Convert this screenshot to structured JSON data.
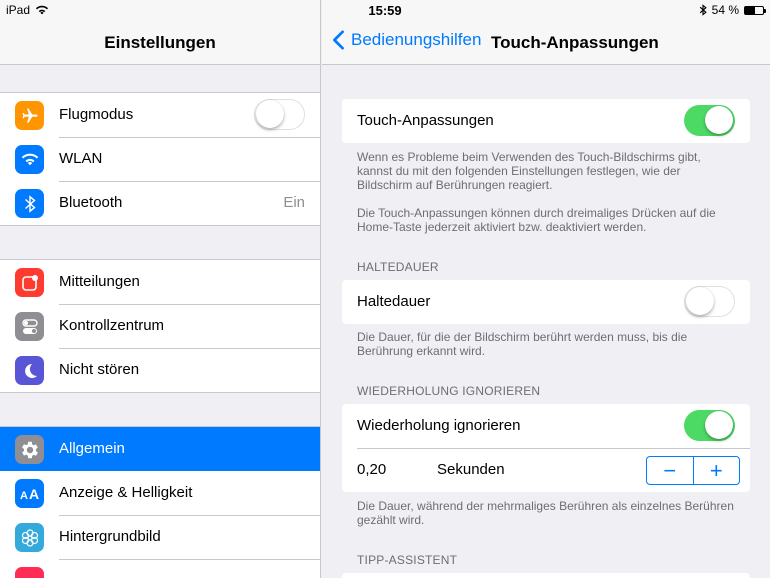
{
  "status_bar": {
    "device": "iPad",
    "time": "15:59",
    "battery": "54 %",
    "battery_fraction": 0.54
  },
  "master": {
    "title": "Einstellungen",
    "groups": [
      [
        {
          "label": "Flugmodus",
          "icon": "airplane-icon",
          "color": "#ff9500",
          "switch": "off"
        },
        {
          "label": "WLAN",
          "icon": "wifi-icon",
          "color": "#007aff"
        },
        {
          "label": "Bluetooth",
          "icon": "bluetooth-icon",
          "color": "#007aff",
          "value": "Ein"
        }
      ],
      [
        {
          "label": "Mitteilungen",
          "icon": "notifications-icon",
          "color": "#ff3b30"
        },
        {
          "label": "Kontrollzentrum",
          "icon": "control-center-icon",
          "color": "#8e8e93"
        },
        {
          "label": "Nicht stören",
          "icon": "moon-icon",
          "color": "#5856d6"
        }
      ],
      [
        {
          "label": "Allgemein",
          "icon": "gear-icon",
          "color": "#8e8e93",
          "selected": true
        },
        {
          "label": "Anzeige & Helligkeit",
          "icon": "display-brightness-icon",
          "color": "#007aff"
        },
        {
          "label": "Hintergrundbild",
          "icon": "wallpaper-icon",
          "color": "#34aadc"
        }
      ]
    ]
  },
  "detail": {
    "back_label": "Bedienungshilfen",
    "title": "Touch-Anpassungen",
    "main_toggle": {
      "label": "Touch-Anpassungen",
      "on": true
    },
    "intro_footer_1": "Wenn es Probleme beim Verwenden des Touch-Bildschirms gibt, kannst du mit den folgenden Einstellungen festlegen, wie der Bildschirm auf Berührungen reagiert.",
    "intro_footer_2": "Die Touch-Anpassungen können durch dreimaliges Drücken auf die Home-Taste jederzeit aktiviert bzw. deaktiviert werden.",
    "hold_section": {
      "header": "HALTEDAUER",
      "label": "Haltedauer",
      "on": false,
      "footer": "Die Dauer, für die der Bildschirm berührt werden muss, bis die Berührung erkannt wird."
    },
    "repeat_section": {
      "header": "WIEDERHOLUNG IGNORIEREN",
      "label": "Wiederholung ignorieren",
      "on": true,
      "value": "0,20",
      "unit": "Sekunden",
      "minus": "−",
      "plus": "+",
      "footer": "Die Dauer, während der mehrmaliges Berühren als einzelnes Berühren gezählt wird."
    },
    "tap_section": {
      "header": "TIPP-ASSISTENT"
    }
  }
}
